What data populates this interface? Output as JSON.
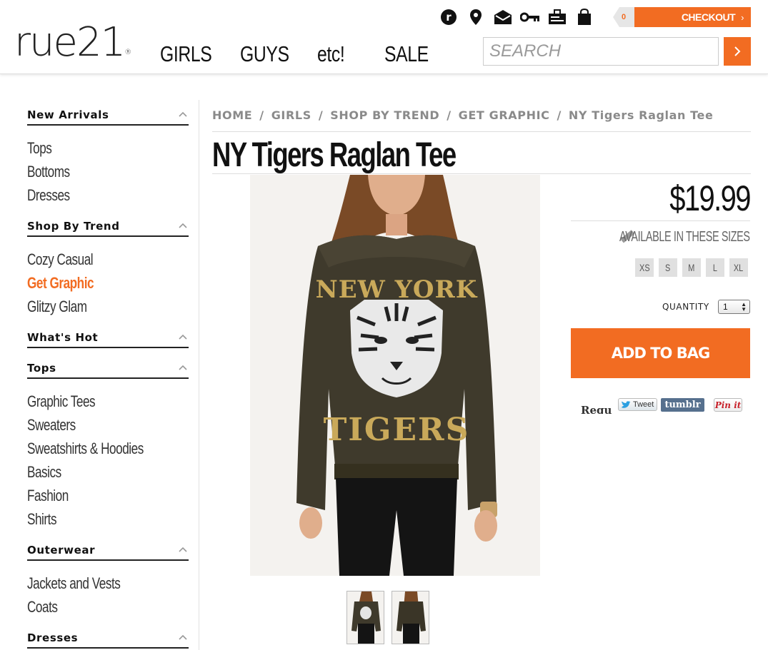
{
  "brand": {
    "name": "rue21",
    "mark": "®",
    "accent_color": "#f26c22"
  },
  "util_icons": [
    "rue21-circle-icon",
    "location-pin-icon",
    "envelope-icon",
    "key-icon",
    "gift-card-icon",
    "shopping-bag-icon"
  ],
  "cart": {
    "count": "0",
    "checkout_label": "CHECKOUT"
  },
  "nav": {
    "items": [
      "GIRLS",
      "GUYS",
      "etc!",
      "SALE"
    ]
  },
  "search": {
    "placeholder": "SEARCH"
  },
  "sidebar": {
    "sections": [
      {
        "title": "New Arrivals",
        "items": [
          "Tops",
          "Bottoms",
          "Dresses"
        ]
      },
      {
        "title": "Shop By Trend",
        "items": [
          "Cozy Casual",
          "Get Graphic",
          "Glitzy Glam"
        ]
      },
      {
        "title": "What's Hot",
        "items": []
      },
      {
        "title": "Tops",
        "items": [
          "Graphic Tees",
          "Sweaters",
          "Sweatshirts & Hoodies",
          "Basics",
          "Fashion",
          "Shirts"
        ]
      },
      {
        "title": "Outerwear",
        "items": [
          "Jackets and Vests",
          "Coats"
        ]
      },
      {
        "title": "Dresses",
        "items": []
      }
    ],
    "active_item": "Get Graphic"
  },
  "breadcrumb": [
    "HOME",
    "GIRLS",
    "SHOP BY TREND",
    "GET GRAPHIC",
    "NY Tigers Raglan Tee"
  ],
  "breadcrumb_separator": "/",
  "product": {
    "title": "NY Tigers Raglan Tee",
    "price": "$19.99",
    "availability_label": "AVAILABLE IN THESE SIZES",
    "sizes": [
      "XS",
      "S",
      "M",
      "L",
      "XL"
    ],
    "quantity_label": "QUANTITY",
    "quantity_value": "1",
    "add_to_bag_label": "ADD TO BAG",
    "shirt_text_top": "NEW YORK",
    "shirt_text_bottom": "TIGERS"
  },
  "social": {
    "partial_text": "Requ",
    "tweet": "Tweet",
    "tumblr": "tumblr",
    "pinit": "Pin it"
  }
}
